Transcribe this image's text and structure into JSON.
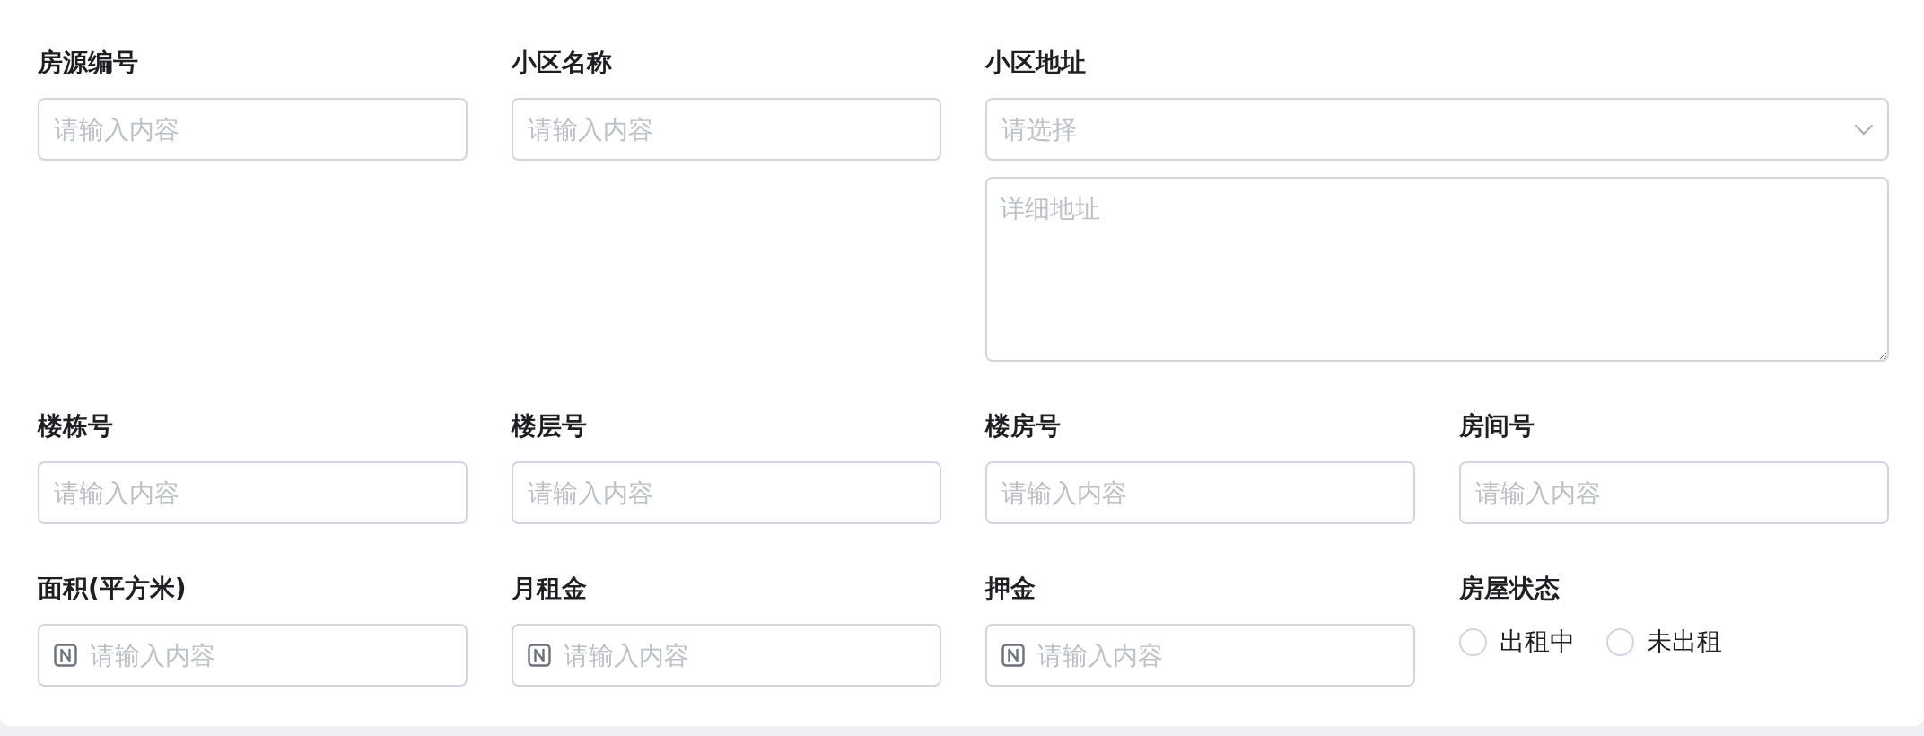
{
  "fields": [
    {
      "kind": "text",
      "label": "房源编号",
      "placeholder": "请输入内容"
    },
    {
      "kind": "text",
      "label": "小区名称",
      "placeholder": "请输入内容"
    },
    {
      "kind": "address",
      "label": "小区地址",
      "select": {
        "placeholder": "请选择"
      },
      "detail": {
        "placeholder": "详细地址"
      }
    },
    {
      "kind": "text",
      "label": "楼栋号",
      "placeholder": "请输入内容"
    },
    {
      "kind": "text",
      "label": "楼层号",
      "placeholder": "请输入内容"
    },
    {
      "kind": "text",
      "label": "楼房号",
      "placeholder": "请输入内容"
    },
    {
      "kind": "text",
      "label": "房间号",
      "placeholder": "请输入内容"
    },
    {
      "kind": "number",
      "label": "面积(平方米)",
      "placeholder": "请输入内容"
    },
    {
      "kind": "number",
      "label": "月租金",
      "placeholder": "请输入内容"
    },
    {
      "kind": "number",
      "label": "押金",
      "placeholder": "请输入内容"
    },
    {
      "kind": "radio",
      "label": "房屋状态",
      "options": [
        {
          "label": "出租中",
          "selected": false
        },
        {
          "label": "未出租",
          "selected": false
        }
      ]
    }
  ]
}
